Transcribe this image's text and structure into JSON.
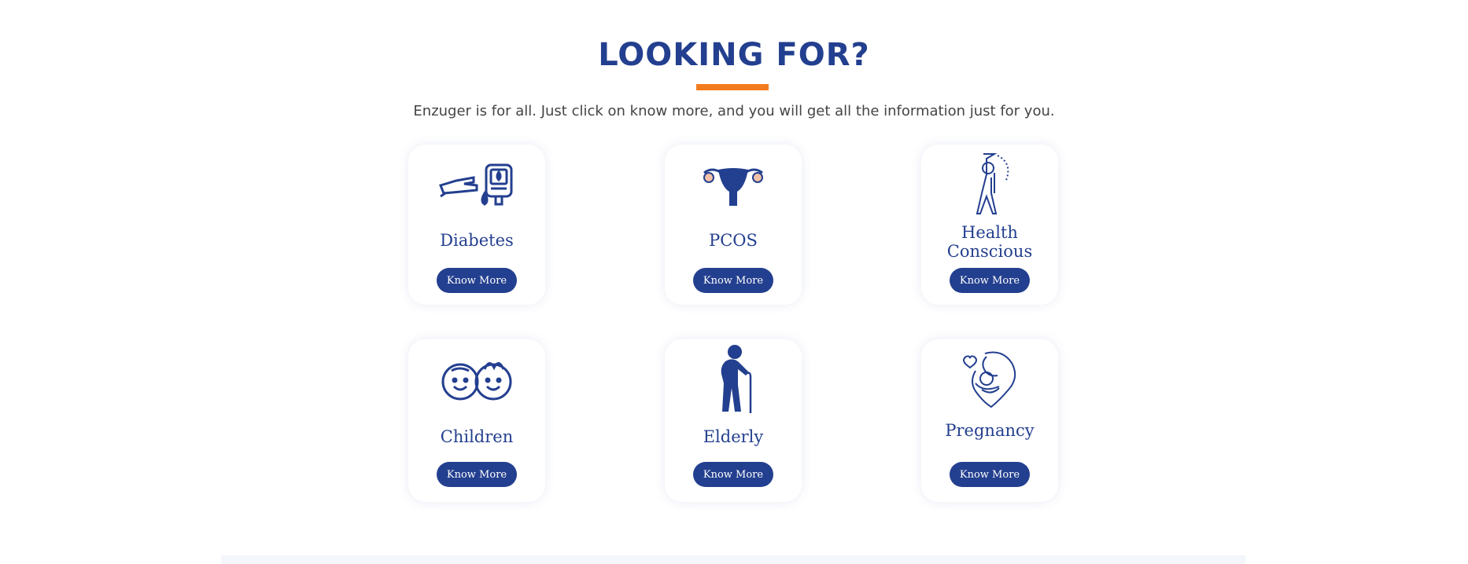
{
  "section": {
    "title": "LOOKING FOR?",
    "subtitle": "Enzuger is for all. Just click on know more, and you will get all the information just for you."
  },
  "colors": {
    "primary": "#233f8f",
    "accent": "#f47c20",
    "text": "#444444"
  },
  "cards": [
    {
      "label": "Diabetes",
      "button": "Know More",
      "icon": "glucose-meter-icon"
    },
    {
      "label": "PCOS",
      "button": "Know More",
      "icon": "uterus-icon"
    },
    {
      "label": "Health\nConscious",
      "button": "Know More",
      "icon": "stretching-person-icon"
    },
    {
      "label": "Children",
      "button": "Know More",
      "icon": "children-faces-icon"
    },
    {
      "label": "Elderly",
      "button": "Know More",
      "icon": "elderly-cane-icon"
    },
    {
      "label": "Pregnancy",
      "button": "Know More",
      "icon": "mother-baby-icon"
    }
  ]
}
